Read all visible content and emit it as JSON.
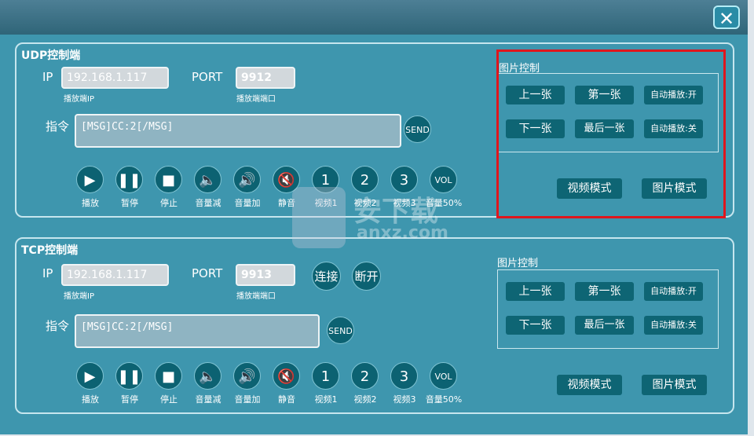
{
  "window": {
    "close_icon": "close-icon"
  },
  "udp": {
    "title": "UDP控制端",
    "ip_label": "IP",
    "ip_value": "192.168.1.117",
    "ip_sub": "播放端IP",
    "port_label": "PORT",
    "port_value": "9912",
    "port_sub": "播放端端口",
    "cmd_label": "指令",
    "cmd_value": "[MSG]CC:2[/MSG]",
    "send": "SEND",
    "controls": [
      {
        "icon": "play-icon",
        "label": "播放"
      },
      {
        "icon": "pause-icon",
        "label": "暂停"
      },
      {
        "icon": "stop-icon",
        "label": "停止"
      },
      {
        "icon": "volume-down-icon",
        "label": "音量减"
      },
      {
        "icon": "volume-up-icon",
        "label": "音量加"
      },
      {
        "icon": "mute-icon",
        "label": "静音"
      },
      {
        "text": "1",
        "label": "视频1"
      },
      {
        "text": "2",
        "label": "视频2"
      },
      {
        "text": "3",
        "label": "视频3"
      },
      {
        "text": "VOL",
        "label": "音量50%"
      }
    ],
    "pic": {
      "title": "图片控制",
      "prev": "上一张",
      "first": "第一张",
      "auto_on": "自动播放:开",
      "next": "下一张",
      "last": "最后一张",
      "auto_off": "自动播放:关",
      "video_mode": "视频模式",
      "pic_mode": "图片模式"
    }
  },
  "tcp": {
    "title": "TCP控制端",
    "ip_label": "IP",
    "ip_value": "192.168.1.117",
    "ip_sub": "播放端IP",
    "port_label": "PORT",
    "port_value": "9913",
    "port_sub": "播放端端口",
    "connect": "连接",
    "disconnect": "断开",
    "cmd_label": "指令",
    "cmd_value": "[MSG]CC:2[/MSG]",
    "send": "SEND",
    "controls": [
      {
        "icon": "play-icon",
        "label": "播放"
      },
      {
        "icon": "pause-icon",
        "label": "暂停"
      },
      {
        "icon": "stop-icon",
        "label": "停止"
      },
      {
        "icon": "volume-down-icon",
        "label": "音量减"
      },
      {
        "icon": "volume-up-icon",
        "label": "音量加"
      },
      {
        "icon": "mute-icon",
        "label": "静音"
      },
      {
        "text": "1",
        "label": "视频1"
      },
      {
        "text": "2",
        "label": "视频2"
      },
      {
        "text": "3",
        "label": "视频3"
      },
      {
        "text": "VOL",
        "label": "音量50%"
      }
    ],
    "pic": {
      "title": "图片控制",
      "prev": "上一张",
      "first": "第一张",
      "auto_on": "自动播放:开",
      "next": "下一张",
      "last": "最后一张",
      "auto_off": "自动播放:关",
      "video_mode": "视频模式",
      "pic_mode": "图片模式"
    }
  },
  "watermark": {
    "text": "安下载",
    "domain": "anxz.com"
  },
  "colors": {
    "window": "#3e96ae",
    "button": "#0e6574",
    "highlight": "#e0161d"
  }
}
